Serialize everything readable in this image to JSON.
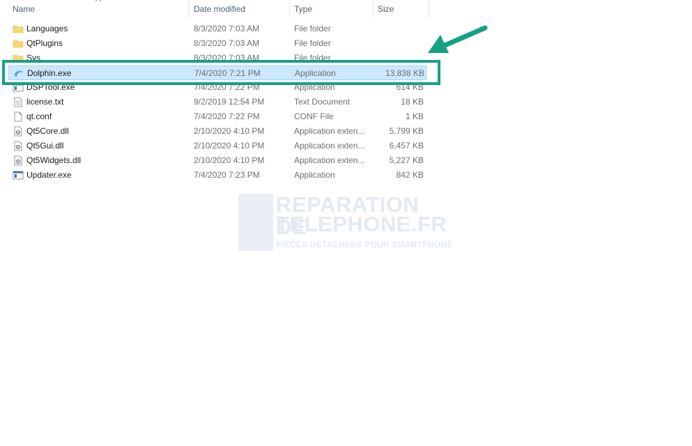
{
  "columns": {
    "name": "Name",
    "date": "Date modified",
    "type": "Type",
    "size": "Size"
  },
  "files": [
    {
      "name": "Languages",
      "date": "8/3/2020 7:03 AM",
      "type": "File folder",
      "size": "",
      "icon": "folder-icon"
    },
    {
      "name": "QtPlugins",
      "date": "8/3/2020 7:03 AM",
      "type": "File folder",
      "size": "",
      "icon": "folder-icon"
    },
    {
      "name": "Sys",
      "date": "8/3/2020 7:03 AM",
      "type": "File folder",
      "size": "",
      "icon": "folder-icon"
    },
    {
      "name": "Dolphin.exe",
      "date": "7/4/2020 7:21 PM",
      "type": "Application",
      "size": "13,838 KB",
      "icon": "dolphin-icon",
      "selected": true
    },
    {
      "name": "DSPTool.exe",
      "date": "7/4/2020 7:22 PM",
      "type": "Application",
      "size": "614 KB",
      "icon": "application-icon"
    },
    {
      "name": "license.txt",
      "date": "9/2/2019 12:54 PM",
      "type": "Text Document",
      "size": "18 KB",
      "icon": "text-document-icon"
    },
    {
      "name": "qt.conf",
      "date": "7/4/2020 7:22 PM",
      "type": "CONF File",
      "size": "1 KB",
      "icon": "file-icon"
    },
    {
      "name": "Qt5Core.dll",
      "date": "2/10/2020 4:10 PM",
      "type": "Application exten...",
      "size": "5,799 KB",
      "icon": "dll-icon"
    },
    {
      "name": "Qt5Gui.dll",
      "date": "2/10/2020 4:10 PM",
      "type": "Application exten...",
      "size": "6,457 KB",
      "icon": "dll-icon"
    },
    {
      "name": "Qt5Widgets.dll",
      "date": "2/10/2020 4:10 PM",
      "type": "Application exten...",
      "size": "5,227 KB",
      "icon": "dll-icon"
    },
    {
      "name": "Updater.exe",
      "date": "7/4/2020 7:23 PM",
      "type": "Application",
      "size": "842 KB",
      "icon": "application-icon"
    }
  ],
  "watermark": {
    "line1": "REPARATION DE",
    "line2": "TELEPHONE.FR",
    "line3": "PIECES DETACHEES POUR SMARTPHONE"
  },
  "colors": {
    "highlight": "#16a085",
    "selection": "#cce8ff",
    "folder": "#f8d775"
  }
}
